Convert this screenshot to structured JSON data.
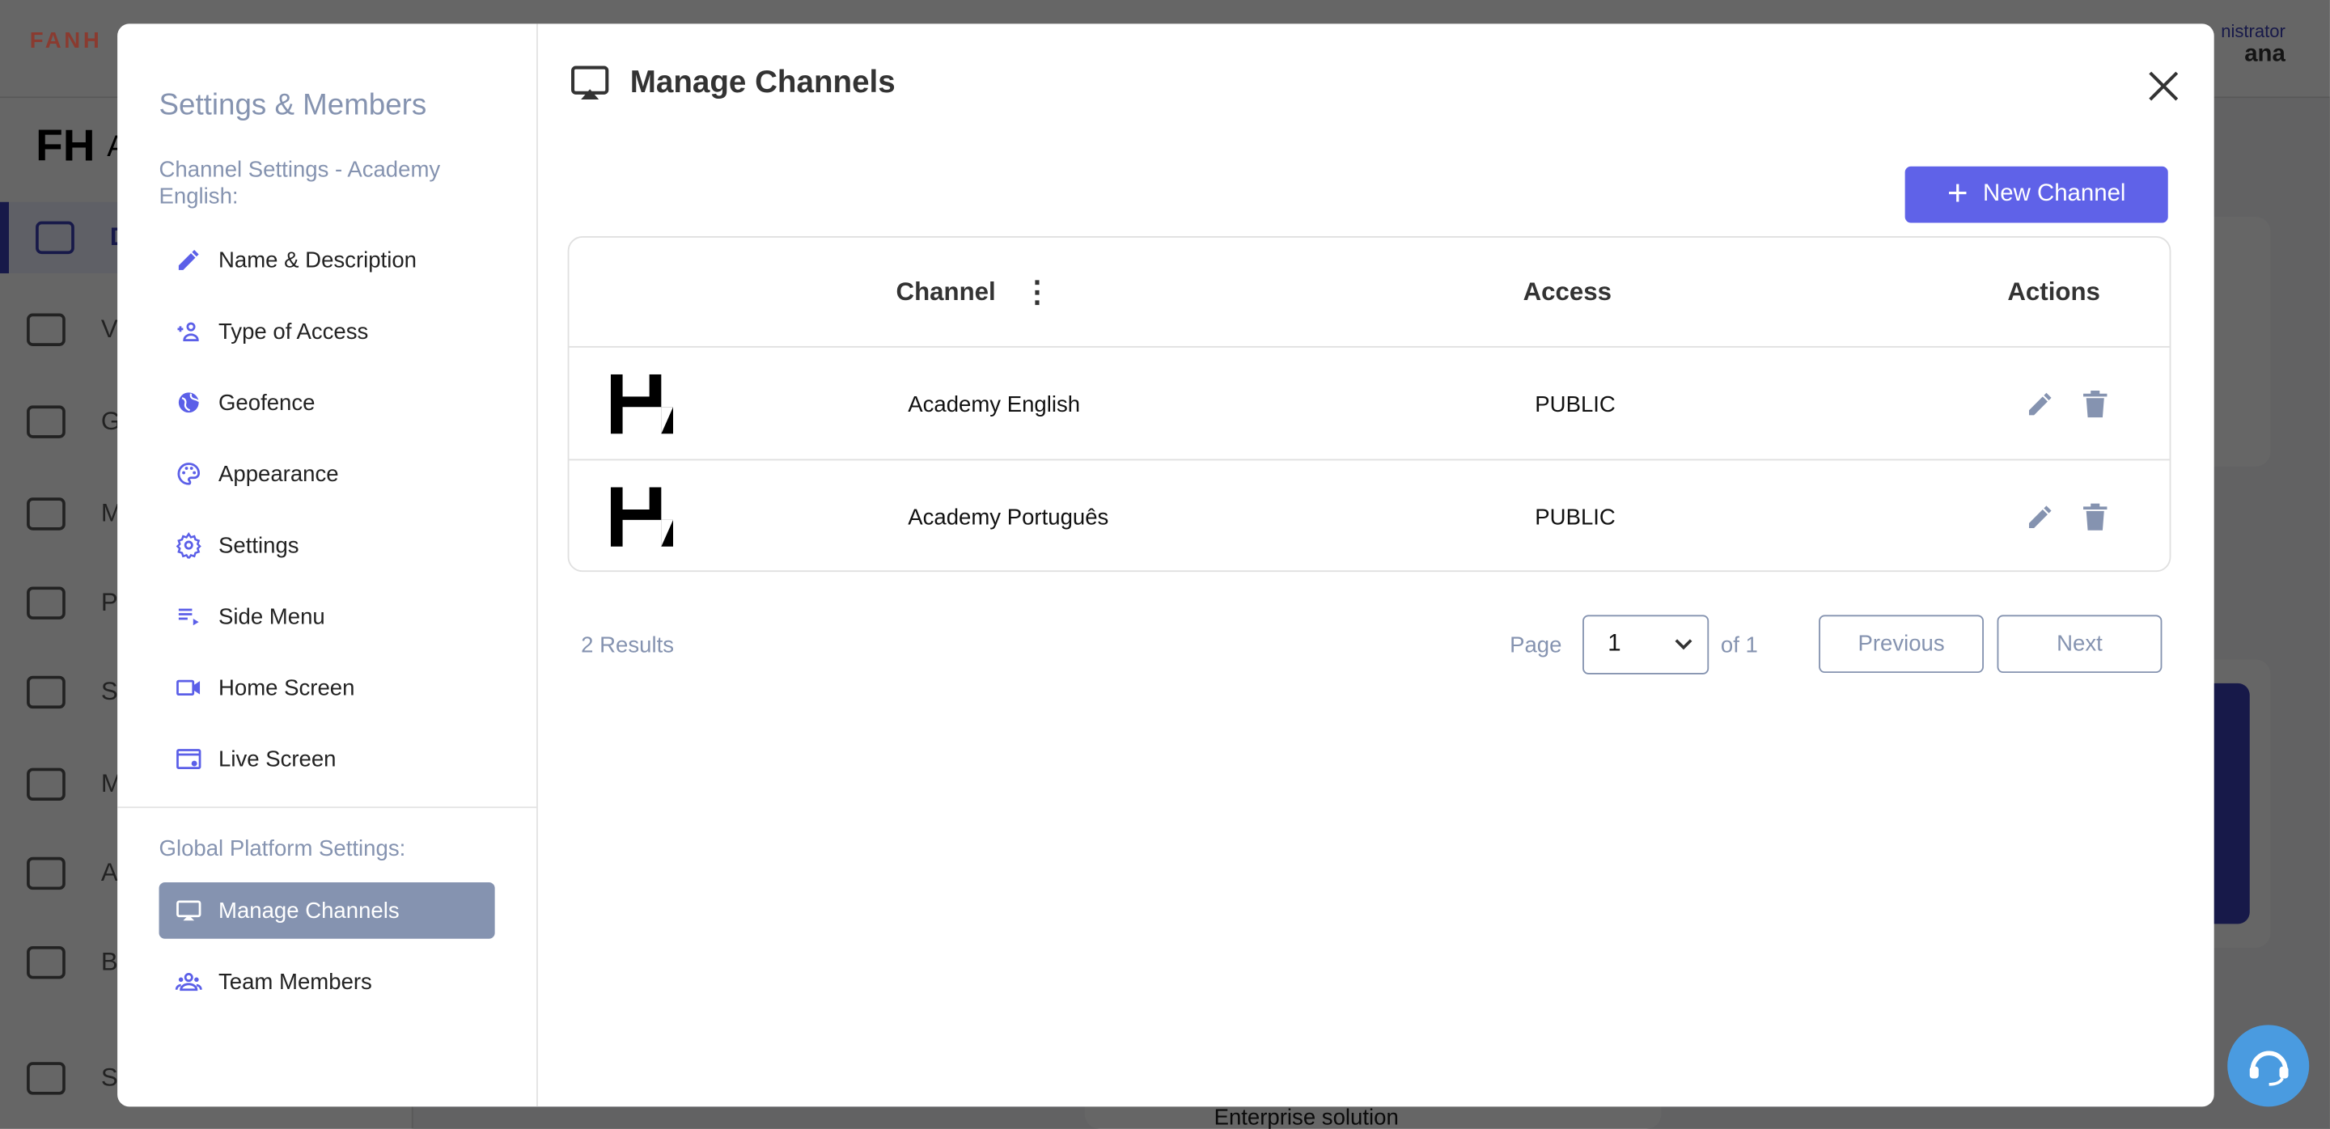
{
  "background": {
    "logo": "FANH",
    "brand_letters": "A",
    "nav": [
      {
        "label": "D",
        "icon": "home-icon"
      },
      {
        "label": "Vic",
        "icon": "play-circle-icon"
      },
      {
        "label": "Go",
        "icon": "tv-play-icon"
      },
      {
        "label": "Ma",
        "icon": "folder-gear-icon"
      },
      {
        "label": "Pe",
        "icon": "people-icon"
      },
      {
        "label": "Sal",
        "icon": "dollar-icon"
      },
      {
        "label": "Ma",
        "icon": "megaphone-icon"
      },
      {
        "label": "An",
        "icon": "chart-icon"
      },
      {
        "label": "Bil",
        "icon": "invoice-icon"
      },
      {
        "label": "Se",
        "icon": "gear-icon"
      }
    ],
    "user_role": "nistrator",
    "user_name": "ana",
    "card_text": "Enterprise solution"
  },
  "modal": {
    "sidebar": {
      "title": "Settings & Members",
      "channel_section": "Channel Settings - Academy English:",
      "channel_items": [
        {
          "label": "Name & Description",
          "icon": "pencil-icon"
        },
        {
          "label": "Type of Access",
          "icon": "group-add-icon"
        },
        {
          "label": "Geofence",
          "icon": "globe-icon"
        },
        {
          "label": "Appearance",
          "icon": "palette-icon"
        },
        {
          "label": "Settings",
          "icon": "gear-icon"
        },
        {
          "label": "Side Menu",
          "icon": "playlist-icon"
        },
        {
          "label": "Home Screen",
          "icon": "video-camera-icon"
        },
        {
          "label": "Live Screen",
          "icon": "screen-settings-icon"
        }
      ],
      "global_section": "Global Platform Settings:",
      "global_items": [
        {
          "label": "Manage Channels",
          "icon": "airplay-icon",
          "active": true
        },
        {
          "label": "Team Members",
          "icon": "group-icon"
        }
      ]
    },
    "title": "Manage Channels",
    "new_button": "New Channel",
    "table": {
      "headers": {
        "channel": "Channel",
        "access": "Access",
        "actions": "Actions"
      },
      "rows": [
        {
          "name": "Academy English",
          "access": "PUBLIC"
        },
        {
          "name": "Academy Português",
          "access": "PUBLIC"
        }
      ]
    },
    "pagination": {
      "results": "2 Results",
      "page_label": "Page",
      "page": "1",
      "of": "of 1",
      "previous": "Previous",
      "next": "Next"
    }
  },
  "colors": {
    "accent": "#5f62e8",
    "muted": "#8593b0",
    "help": "#4a9be0"
  }
}
